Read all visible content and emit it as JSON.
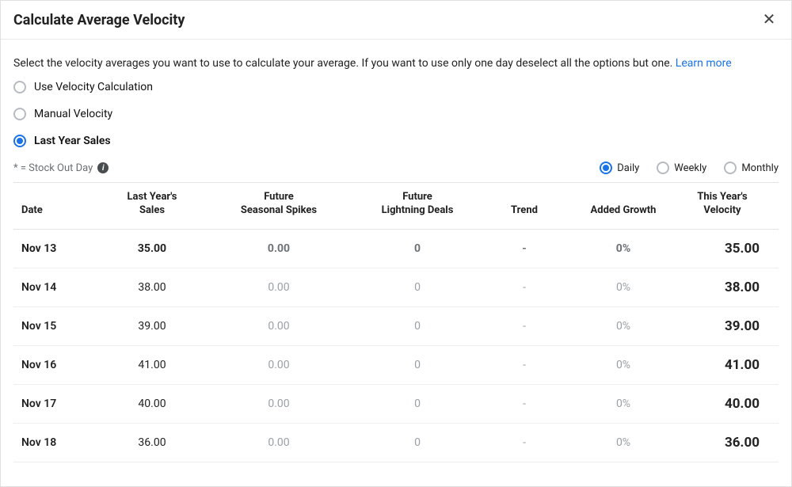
{
  "header": {
    "title": "Calculate Average Velocity"
  },
  "intro": {
    "text": "Select the velocity averages you want to use to calculate your average. If you want to use only one day deselect all the options but one.",
    "learn_more": "Learn more"
  },
  "calc_options": [
    {
      "label": "Use Velocity Calculation",
      "selected": false
    },
    {
      "label": "Manual Velocity",
      "selected": false
    },
    {
      "label": "Last Year Sales",
      "selected": true
    }
  ],
  "legend": {
    "note": "* = Stock Out Day"
  },
  "period_options": [
    {
      "label": "Daily",
      "selected": true
    },
    {
      "label": "Weekly",
      "selected": false
    },
    {
      "label": "Monthly",
      "selected": false
    }
  ],
  "table": {
    "headers": {
      "date": "Date",
      "last_year_sales_l1": "Last Year's",
      "last_year_sales_l2": "Sales",
      "future_spikes_l1": "Future",
      "future_spikes_l2": "Seasonal Spikes",
      "future_deals_l1": "Future",
      "future_deals_l2": "Lightning Deals",
      "trend": "Trend",
      "added_growth": "Added Growth",
      "this_year_velocity_l1": "This Year's",
      "this_year_velocity_l2": "Velocity"
    },
    "rows": [
      {
        "date": "Nov 13",
        "sales": "35.00",
        "spikes": "0.00",
        "deals": "0",
        "trend": "-",
        "growth": "0%",
        "velocity": "35.00",
        "emph": true
      },
      {
        "date": "Nov 14",
        "sales": "38.00",
        "spikes": "0.00",
        "deals": "0",
        "trend": "-",
        "growth": "0%",
        "velocity": "38.00",
        "emph": false
      },
      {
        "date": "Nov 15",
        "sales": "39.00",
        "spikes": "0.00",
        "deals": "0",
        "trend": "-",
        "growth": "0%",
        "velocity": "39.00",
        "emph": false
      },
      {
        "date": "Nov 16",
        "sales": "41.00",
        "spikes": "0.00",
        "deals": "0",
        "trend": "-",
        "growth": "0%",
        "velocity": "41.00",
        "emph": false
      },
      {
        "date": "Nov 17",
        "sales": "40.00",
        "spikes": "0.00",
        "deals": "0",
        "trend": "-",
        "growth": "0%",
        "velocity": "40.00",
        "emph": false
      },
      {
        "date": "Nov 18",
        "sales": "36.00",
        "spikes": "0.00",
        "deals": "0",
        "trend": "-",
        "growth": "0%",
        "velocity": "36.00",
        "emph": false
      }
    ]
  }
}
